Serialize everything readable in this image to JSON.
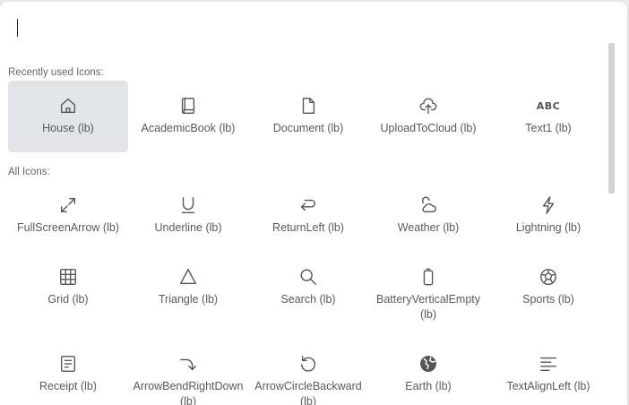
{
  "search": {
    "value": "",
    "placeholder": ""
  },
  "recent": {
    "label": "Recently used Icons:",
    "items": [
      {
        "label": "House (lb)",
        "icon": "house-icon"
      },
      {
        "label": "AcademicBook (lb)",
        "icon": "academic-book-icon"
      },
      {
        "label": "Document (lb)",
        "icon": "document-icon"
      },
      {
        "label": "UploadToCloud (lb)",
        "icon": "upload-to-cloud-icon"
      },
      {
        "label": "Text1 (lb)",
        "icon": "text1-icon",
        "glyph": "ABC"
      }
    ]
  },
  "all": {
    "label": "All Icons:",
    "items": [
      {
        "label": "FullScreenArrow (lb)",
        "icon": "full-screen-arrow-icon"
      },
      {
        "label": "Underline (lb)",
        "icon": "underline-icon"
      },
      {
        "label": "ReturnLeft (lb)",
        "icon": "return-left-icon"
      },
      {
        "label": "Weather (lb)",
        "icon": "weather-icon"
      },
      {
        "label": "Lightning (lb)",
        "icon": "lightning-icon"
      },
      {
        "label": "Grid (lb)",
        "icon": "grid-icon"
      },
      {
        "label": "Triangle (lb)",
        "icon": "triangle-icon"
      },
      {
        "label": "Search (lb)",
        "icon": "search-icon"
      },
      {
        "label": "BatteryVerticalEmpty (lb)",
        "icon": "battery-vertical-empty-icon"
      },
      {
        "label": "Sports (lb)",
        "icon": "sports-icon"
      },
      {
        "label": "Receipt (lb)",
        "icon": "receipt-icon"
      },
      {
        "label": "ArrowBendRightDown (lb)",
        "icon": "arrow-bend-right-down-icon"
      },
      {
        "label": "ArrowCircleBackward (lb)",
        "icon": "arrow-circle-backward-icon"
      },
      {
        "label": "Earth (lb)",
        "icon": "earth-icon"
      },
      {
        "label": "TextAlignLeft (lb)",
        "icon": "text-align-left-icon"
      }
    ]
  },
  "colors": {
    "selected_bg": "#e2e4e8",
    "icon": "#555555",
    "label_text": "#5a5a5a"
  }
}
